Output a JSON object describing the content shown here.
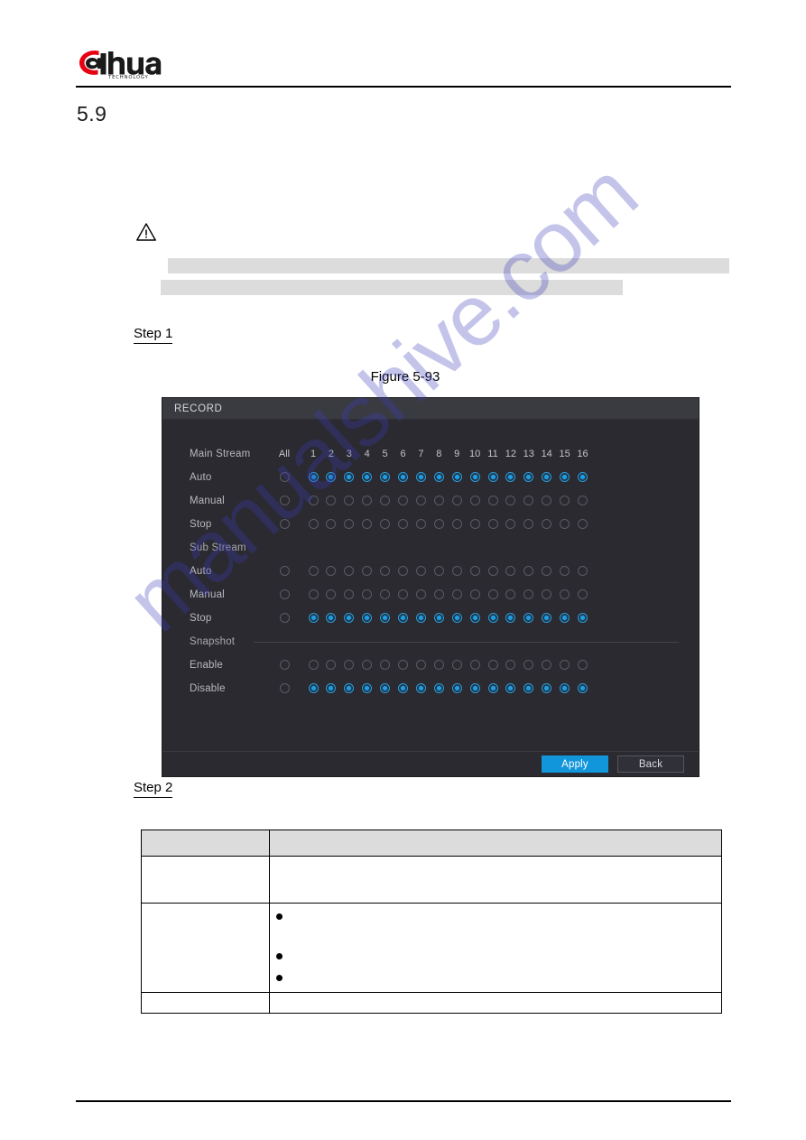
{
  "page": {
    "section_number": "5.9",
    "watermark_text": "manualshive.com",
    "brand": {
      "name": "alhua",
      "wordmark": "dahua",
      "tagline": "TECHNOLOGY",
      "accent_color": "#e60012",
      "text_color": "#000000"
    }
  },
  "note": {
    "icon": "warning-triangle-icon",
    "redacted_lines": [
      "",
      ""
    ]
  },
  "steps": {
    "step_1": "Step 1",
    "step_2": "Step 2"
  },
  "figure": {
    "caption": "Figure 5-93"
  },
  "dialog": {
    "title": "RECORD",
    "columns": {
      "all_label": "All",
      "channels": [
        "1",
        "2",
        "3",
        "4",
        "5",
        "6",
        "7",
        "8",
        "9",
        "10",
        "11",
        "12",
        "13",
        "14",
        "15",
        "16"
      ]
    },
    "groups": [
      {
        "name": "Main Stream",
        "is_header": true,
        "rows": [
          {
            "label": "Auto",
            "all_selected": false,
            "channels_selected": [
              true,
              true,
              true,
              true,
              true,
              true,
              true,
              true,
              true,
              true,
              true,
              true,
              true,
              true,
              true,
              true
            ]
          },
          {
            "label": "Manual",
            "all_selected": false,
            "channels_selected": [
              false,
              false,
              false,
              false,
              false,
              false,
              false,
              false,
              false,
              false,
              false,
              false,
              false,
              false,
              false,
              false
            ]
          },
          {
            "label": "Stop",
            "all_selected": false,
            "channels_selected": [
              false,
              false,
              false,
              false,
              false,
              false,
              false,
              false,
              false,
              false,
              false,
              false,
              false,
              false,
              false,
              false
            ]
          }
        ]
      },
      {
        "name": "Sub Stream",
        "is_header": true,
        "rows": [
          {
            "label": "Auto",
            "all_selected": false,
            "channels_selected": [
              false,
              false,
              false,
              false,
              false,
              false,
              false,
              false,
              false,
              false,
              false,
              false,
              false,
              false,
              false,
              false
            ]
          },
          {
            "label": "Manual",
            "all_selected": false,
            "channels_selected": [
              false,
              false,
              false,
              false,
              false,
              false,
              false,
              false,
              false,
              false,
              false,
              false,
              false,
              false,
              false,
              false
            ]
          },
          {
            "label": "Stop",
            "all_selected": false,
            "channels_selected": [
              true,
              true,
              true,
              true,
              true,
              true,
              true,
              true,
              true,
              true,
              true,
              true,
              true,
              true,
              true,
              true
            ]
          }
        ]
      },
      {
        "name": "Snapshot",
        "is_header": true,
        "has_separator": true,
        "rows": [
          {
            "label": "Enable",
            "all_selected": false,
            "channels_selected": [
              false,
              false,
              false,
              false,
              false,
              false,
              false,
              false,
              false,
              false,
              false,
              false,
              false,
              false,
              false,
              false
            ]
          },
          {
            "label": "Disable",
            "all_selected": false,
            "channels_selected": [
              true,
              true,
              true,
              true,
              true,
              true,
              true,
              true,
              true,
              true,
              true,
              true,
              true,
              true,
              true,
              true
            ]
          }
        ]
      }
    ],
    "buttons": {
      "apply": "Apply",
      "back": "Back"
    },
    "colors": {
      "titlebar": "#3a3b41",
      "body": "#2a2a30",
      "accent": "#1296db",
      "radio_on": "#1e9ee6",
      "label_text": "#b9bac0"
    }
  },
  "param_table": {
    "header": [
      "",
      ""
    ],
    "rows": [
      {
        "col1": "",
        "col2": "",
        "bullets": []
      },
      {
        "col1": "",
        "col2": "",
        "bullets": [
          "",
          "",
          ""
        ]
      },
      {
        "col1": "",
        "col2": "",
        "bullets": []
      }
    ]
  }
}
